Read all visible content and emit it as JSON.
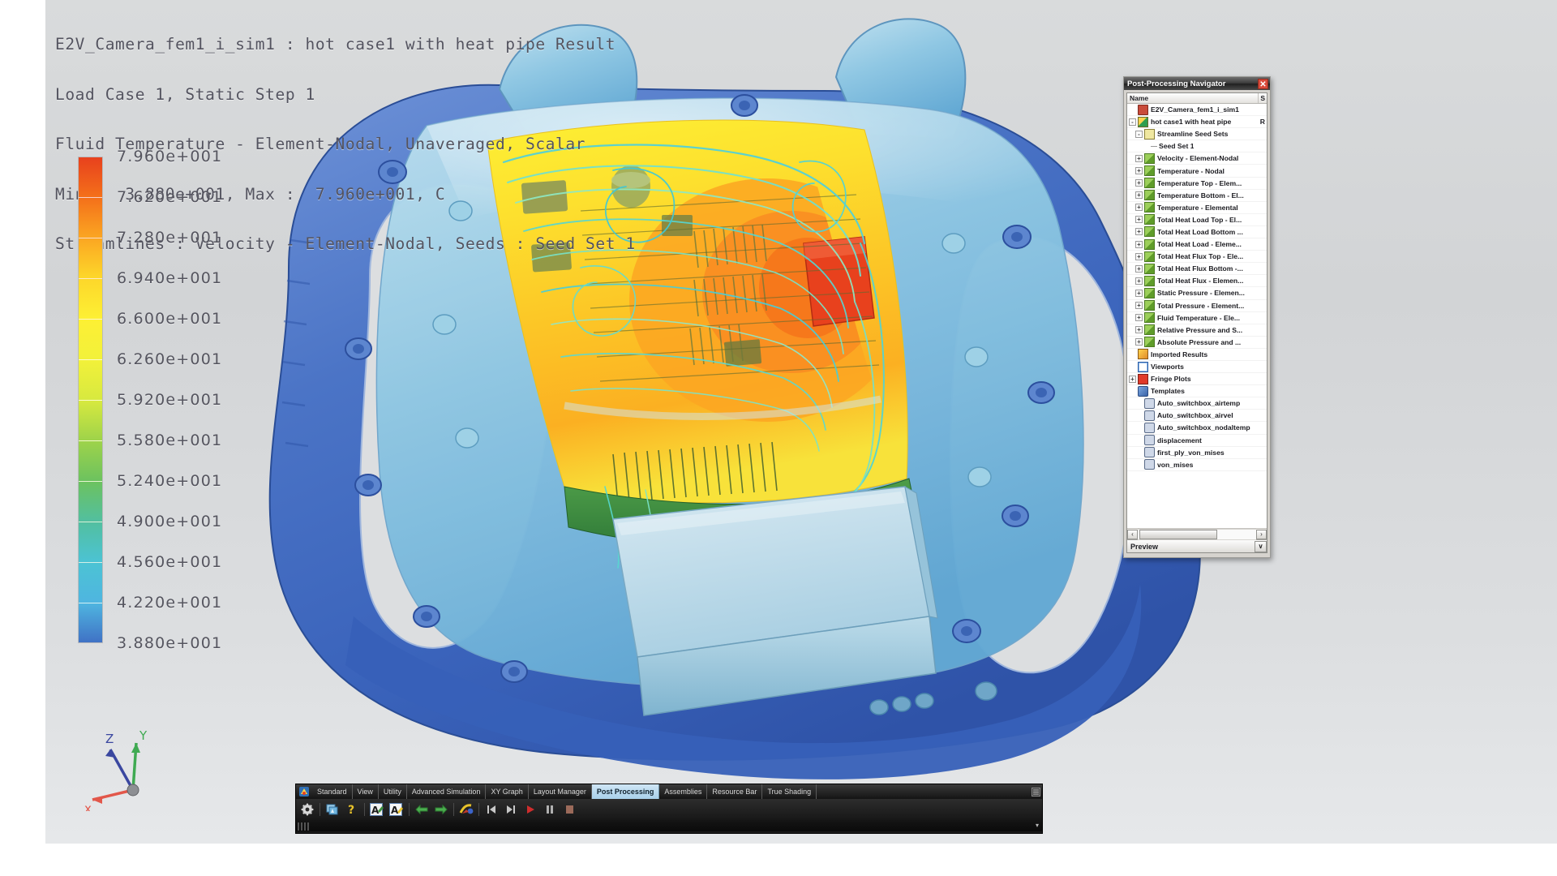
{
  "annotation": {
    "lines": [
      "E2V_Camera_fem1_i_sim1 : hot case1 with heat pipe Result",
      "Load Case 1, Static Step 1",
      "Fluid Temperature - Element-Nodal, Unaveraged, Scalar",
      "Min :  3.880e+001, Max :  7.960e+001, C",
      "Streamlines : Velocity - Element-Nodal, Seeds : Seed Set 1"
    ]
  },
  "legend": {
    "title": "Fluid Temperature",
    "unit": "C",
    "min": "3.880e+001",
    "max": "7.960e+001",
    "labels": [
      "7.960e+001",
      "7.620e+001",
      "7.280e+001",
      "6.940e+001",
      "6.600e+001",
      "6.260e+001",
      "5.920e+001",
      "5.580e+001",
      "5.240e+001",
      "4.900e+001",
      "4.560e+001",
      "4.220e+001",
      "3.880e+001"
    ],
    "colors": [
      "#e8411d",
      "#f4701a",
      "#fba622",
      "#fdd72a",
      "#fdf034",
      "#f2f13a",
      "#d7e93f",
      "#9ed34a",
      "#6cc25f",
      "#52bfa0",
      "#4cc3d4",
      "#4fb5e0",
      "#3f6fc4"
    ]
  },
  "triad": {
    "x_label": "x",
    "y_label": "Y",
    "z_label": "Z",
    "x_color": "#e2574a",
    "y_color": "#3faa52",
    "z_color": "#3a47a0"
  },
  "navigator": {
    "title": "Post-Processing Navigator",
    "close_label": "✕",
    "column_header": "Name",
    "column_header_2": "S",
    "preview_label": "Preview",
    "preview_caret": "∨",
    "scroll_left": "‹",
    "scroll_right": "›",
    "tree": [
      {
        "label": "E2V_Camera_fem1_i_sim1",
        "indent": 0,
        "expander": "",
        "icon": "sim-icon",
        "tail": ""
      },
      {
        "label": "hot case1 with heat pipe",
        "indent": 0,
        "expander": "-",
        "icon": "solution-icon",
        "tail": "R"
      },
      {
        "label": "Streamline Seed Sets",
        "indent": 1,
        "expander": "-",
        "icon": "seed-sets-icon",
        "tail": ""
      },
      {
        "label": "Seed Set 1",
        "indent": 2,
        "expander": "",
        "icon": "seed-set-icon",
        "tail": ""
      },
      {
        "label": "Velocity - Element-Nodal",
        "indent": 1,
        "expander": "+",
        "icon": "result-icon",
        "tail": ""
      },
      {
        "label": "Temperature - Nodal",
        "indent": 1,
        "expander": "+",
        "icon": "result-icon",
        "tail": ""
      },
      {
        "label": "Temperature Top - Elem...",
        "indent": 1,
        "expander": "+",
        "icon": "result-icon",
        "tail": ""
      },
      {
        "label": "Temperature Bottom - El...",
        "indent": 1,
        "expander": "+",
        "icon": "result-icon",
        "tail": ""
      },
      {
        "label": "Temperature - Elemental",
        "indent": 1,
        "expander": "+",
        "icon": "result-icon",
        "tail": ""
      },
      {
        "label": "Total Heat Load Top - El...",
        "indent": 1,
        "expander": "+",
        "icon": "result-icon",
        "tail": ""
      },
      {
        "label": "Total Heat Load Bottom ...",
        "indent": 1,
        "expander": "+",
        "icon": "result-icon",
        "tail": ""
      },
      {
        "label": "Total Heat Load - Eleme...",
        "indent": 1,
        "expander": "+",
        "icon": "result-icon",
        "tail": ""
      },
      {
        "label": "Total Heat Flux Top - Ele...",
        "indent": 1,
        "expander": "+",
        "icon": "result-icon",
        "tail": ""
      },
      {
        "label": "Total Heat Flux Bottom -...",
        "indent": 1,
        "expander": "+",
        "icon": "result-icon",
        "tail": ""
      },
      {
        "label": "Total Heat Flux - Elemen...",
        "indent": 1,
        "expander": "+",
        "icon": "result-icon",
        "tail": ""
      },
      {
        "label": "Static Pressure - Elemen...",
        "indent": 1,
        "expander": "+",
        "icon": "result-icon",
        "tail": ""
      },
      {
        "label": "Total Pressure - Element...",
        "indent": 1,
        "expander": "+",
        "icon": "result-icon",
        "tail": ""
      },
      {
        "label": "Fluid Temperature - Ele...",
        "indent": 1,
        "expander": "+",
        "icon": "result-icon",
        "tail": ""
      },
      {
        "label": "Relative Pressure and S...",
        "indent": 1,
        "expander": "+",
        "icon": "result-icon",
        "tail": ""
      },
      {
        "label": "Absolute Pressure and ...",
        "indent": 1,
        "expander": "+",
        "icon": "result-icon",
        "tail": ""
      },
      {
        "label": "Imported Results",
        "indent": 0,
        "expander": "",
        "icon": "imported-results-icon",
        "tail": ""
      },
      {
        "label": "Viewports",
        "indent": 0,
        "expander": "",
        "icon": "viewports-icon",
        "tail": ""
      },
      {
        "label": "Fringe Plots",
        "indent": 0,
        "expander": "+",
        "icon": "fringe-plots-icon",
        "tail": ""
      },
      {
        "label": "Templates",
        "indent": 0,
        "expander": "",
        "icon": "templates-root-icon",
        "tail": ""
      },
      {
        "label": "Auto_switchbox_airtemp",
        "indent": 1,
        "expander": "",
        "icon": "template-icon",
        "tail": ""
      },
      {
        "label": "Auto_switchbox_airvel",
        "indent": 1,
        "expander": "",
        "icon": "template-icon",
        "tail": ""
      },
      {
        "label": "Auto_switchbox_nodaltemp",
        "indent": 1,
        "expander": "",
        "icon": "template-icon",
        "tail": ""
      },
      {
        "label": "displacement",
        "indent": 1,
        "expander": "",
        "icon": "template-icon",
        "tail": ""
      },
      {
        "label": "first_ply_von_mises",
        "indent": 1,
        "expander": "",
        "icon": "template-icon",
        "tail": ""
      },
      {
        "label": "von_mises",
        "indent": 1,
        "expander": "",
        "icon": "template-icon",
        "tail": ""
      }
    ]
  },
  "toolbar": {
    "tabs": [
      {
        "label": "Standard",
        "active": false
      },
      {
        "label": "View",
        "active": false
      },
      {
        "label": "Utility",
        "active": false
      },
      {
        "label": "Advanced Simulation",
        "active": false
      },
      {
        "label": "XY Graph",
        "active": false
      },
      {
        "label": "Layout Manager",
        "active": false
      },
      {
        "label": "Post Processing",
        "active": true
      },
      {
        "label": "Assemblies",
        "active": false
      },
      {
        "label": "Resource Bar",
        "active": false
      },
      {
        "label": "True Shading",
        "active": false
      }
    ],
    "icons": [
      "settings-gear-icon",
      "new-plot-icon",
      "help-question-icon",
      "annotation-edit-icon",
      "annotation-new-icon",
      "previous-result-icon",
      "next-result-icon",
      "animation-setup-icon",
      "skip-to-start-icon",
      "skip-to-end-icon",
      "play-icon",
      "pause-icon",
      "stop-icon"
    ],
    "overflow_caret": "▾"
  },
  "model": {
    "description": "Thermal CFD fringe plot of camera housing with streamlines",
    "body_color": "#3f6fc4",
    "pcb_hot_color": "#e8411d",
    "pcb_warm_color": "#fdd72a"
  }
}
